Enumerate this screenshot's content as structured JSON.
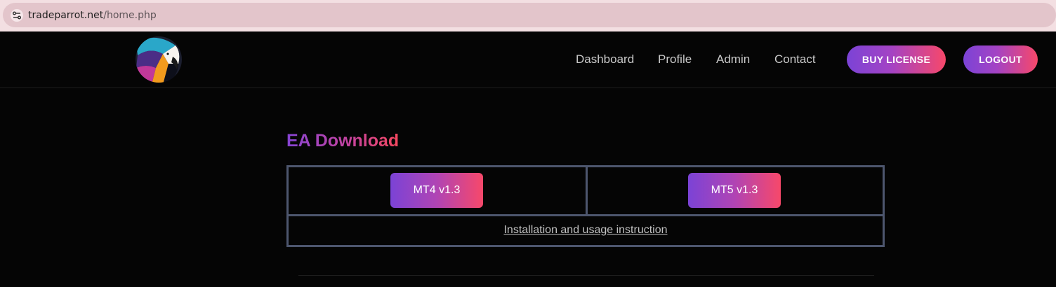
{
  "browser": {
    "url_domain": "tradeparrot.net",
    "url_path": "/home.php"
  },
  "header": {
    "logo_alt": "Trade Parrot logo",
    "nav": [
      "Dashboard",
      "Profile",
      "Admin",
      "Contact"
    ],
    "buy_license_label": "BUY LICENSE",
    "logout_label": "LOGOUT"
  },
  "main": {
    "title": "EA Download",
    "downloads": [
      "MT4 v1.3",
      "MT5 v1.3"
    ],
    "instruction_link": "Installation and usage instruction"
  },
  "colors": {
    "background": "#050505",
    "gradient_start": "#7b43d6",
    "gradient_end": "#f7486a",
    "table_border": "#4d566e"
  }
}
